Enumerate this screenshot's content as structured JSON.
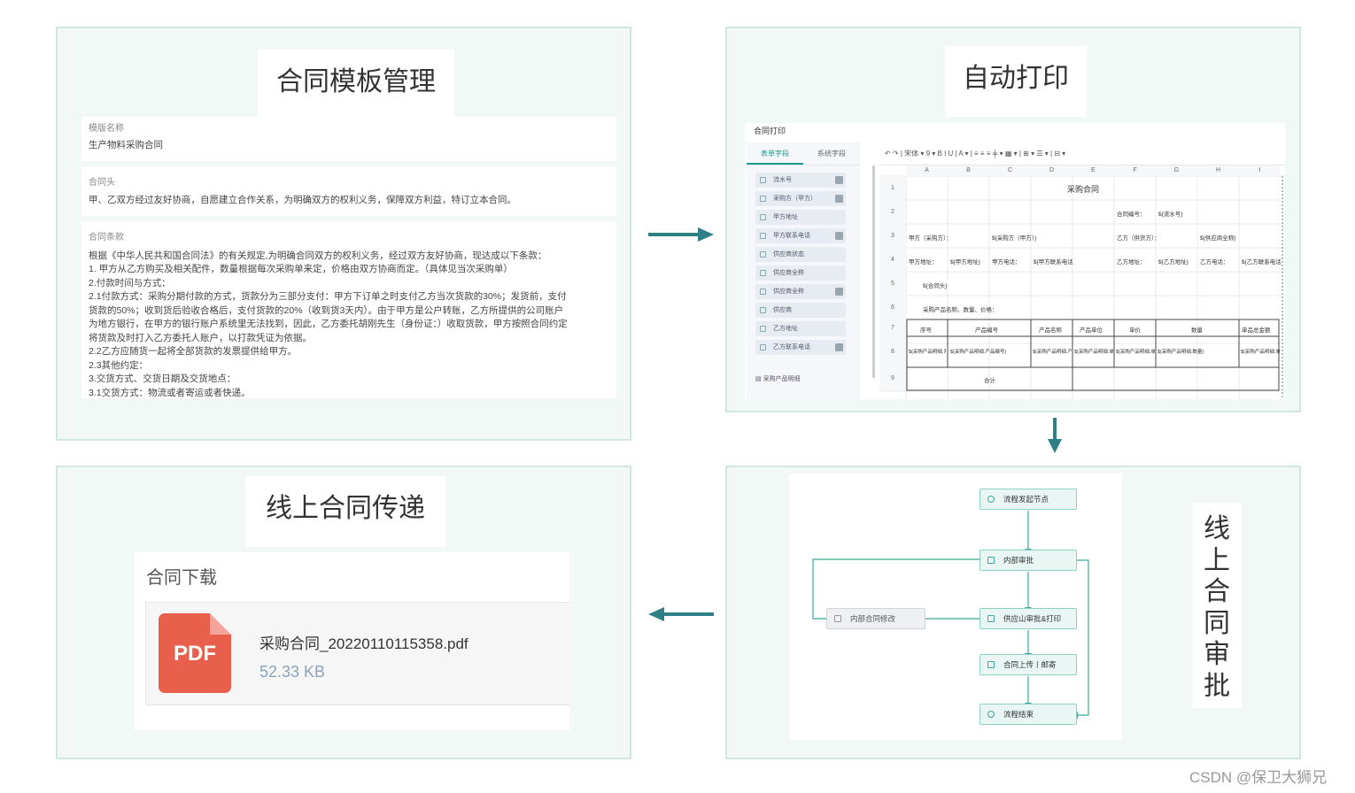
{
  "panels": {
    "template": {
      "title": "合同模板管理",
      "name_label": "模版名称",
      "name_value": "生产物料采购合同",
      "head_label": "合同头",
      "head_value": "甲、乙双方经过友好协商，自愿建立合作关系，为明确双方的权利义务，保障双方利益，特订立本合同。",
      "terms_label": "合同条款",
      "terms_lines": [
        "根据《中华人民共和国合同法》的有关规定,为明确合同双方的权利义务，经过双方友好协商，现达成以下条款：",
        "1. 甲方从乙方购买及相关配件，数量根据每次采购单来定，价格由双方协商而定。（具体见当次采购单）",
        "2.付款时间与方式：",
        "2.1付款方式：采购分期付款的方式，货款分为三部分支付：甲方下订单之时支付乙方当次货款的30%；发货前，支付",
        "货款的50%；收到货后验收合格后，支付货款的20%（收到货3天内）。由于甲方是公户转账，乙方所提供的公司账户",
        "为地方银行，在甲方的银行账户系统里无法找到，因此，乙方委托胡刚先生（身份证：）收取货款，甲方按照合同约定",
        "将货款及时打入乙方委托人账户，以打款凭证为依据。",
        "2.2乙方应随货一起将全部货款的发票提供给甲方。",
        "2.3其他约定：",
        "3.交货方式、交货日期及交货地点：",
        "3.1交货方式：物流或者寄运或者快递。"
      ]
    },
    "print": {
      "title": "自动打印",
      "header": "合同打印",
      "tabs": [
        "表单字段",
        "系统字段"
      ],
      "fields": [
        "流水号",
        "采购方（甲方）",
        "甲方地址",
        "甲方联系电话",
        "供应商状态",
        "供应商全称",
        "供应商全称",
        "供应商",
        "乙方地址",
        "乙方联系电话"
      ],
      "subtable": "采购产品明细",
      "toolbar": "↶  ↷   |   宋体  ▾   9  ▾   B   I   U   |   A ▾   |   ≡   ≡   ≡   ╪ ▾   ▦ ▾   |   ⊞ ▾   ☰ ▾   |   ⊟ ▾",
      "columns": [
        "A",
        "B",
        "C",
        "D",
        "E",
        "F",
        "G",
        "H",
        "I"
      ],
      "rows": [
        "1",
        "2",
        "3",
        "4",
        "5",
        "6",
        "7",
        "8",
        "9"
      ],
      "doc_title": "采购合同",
      "contract_no_label": "合同编号：",
      "contract_no_value": "${流水号}",
      "party_a": "甲方（采购方）：",
      "party_a_value": "${采购方（甲方）}",
      "party_b": "乙方（供货方）：",
      "party_b_value": "${供应商全称}",
      "a_addr": "甲方地址：",
      "a_addr_value": "${甲方地址}",
      "a_tel": "甲方电话：",
      "a_tel_value": "${甲方联系电话}",
      "b_addr": "乙方地址：",
      "b_addr_value": "${乙方地址}",
      "b_tel": "乙方电话：",
      "b_tel_value": "${乙方联系电话}",
      "head_var": "${合同头}",
      "line6": "采购产品名称、数量、价格：",
      "table_headers": [
        "序号",
        "产品编号",
        "产品名称",
        "产品单位",
        "单价",
        "数量",
        "单品总金额"
      ],
      "table_vars": [
        "${采购产品明细.系统序号}",
        "${采购产品明细.产品编号}",
        "${采购产品明细.产品名称}",
        "${采购产品明细.单位}",
        "${采购产品明细.单价}",
        "${采购产品明细.数量}",
        "${采购产品明细.单品总金额}"
      ],
      "total": "合计"
    },
    "approval": {
      "title_chars": [
        "线",
        "上",
        "合",
        "同",
        "审",
        "批"
      ],
      "nodes": [
        "流程发起节点",
        "内部审批",
        "供应山审批&打印",
        "合同上传丨邮寄",
        "流程结束"
      ],
      "side_node": "内部合同修改"
    },
    "delivery": {
      "title": "线上合同传递",
      "download_title": "合同下载",
      "pdf_label": "PDF",
      "file_name": "采购合同_20220110115358.pdf",
      "file_size": "52.33 KB"
    }
  },
  "colors": {
    "panel_border": "#cfe6e2",
    "panel_bg": "#f2f8f6",
    "arrow": "#2f7f86",
    "pdf": "#e8604c",
    "flow_accent": "#3aa89a"
  },
  "watermark": "CSDN @保卫大狮兄"
}
